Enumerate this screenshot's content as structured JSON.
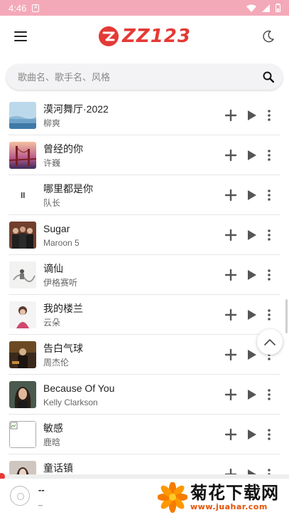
{
  "status_bar": {
    "time": "4:46",
    "notification_glyph": "A"
  },
  "header": {
    "logo_text": "ZZ123",
    "accent_color": "#e53935"
  },
  "search": {
    "placeholder": "歌曲名、歌手名、风格"
  },
  "songs": [
    {
      "title": "漠河舞厅·2022",
      "artist": "柳爽",
      "thumb": "sky-blue-cover"
    },
    {
      "title": "曾经的你",
      "artist": "许巍",
      "thumb": "bridge-sunset-cover"
    },
    {
      "title": "哪里都是你",
      "artist": "队长",
      "thumb": "minimal-white-cover"
    },
    {
      "title": "Sugar",
      "artist": "Maroon 5",
      "thumb": "band-photo-cover"
    },
    {
      "title": "谪仙",
      "artist": "伊格赛听",
      "thumb": "ink-painting-cover"
    },
    {
      "title": "我的楼兰",
      "artist": "云朵",
      "thumb": "singer-portrait-cover"
    },
    {
      "title": "告白气球",
      "artist": "周杰伦",
      "thumb": "jay-chou-cover"
    },
    {
      "title": "Because Of You",
      "artist": "Kelly Clarkson",
      "thumb": "kelly-clarkson-cover"
    },
    {
      "title": "敏感",
      "artist": "鹿晗",
      "thumb": "broken-image"
    },
    {
      "title": "童话镇",
      "artist": "",
      "thumb": "girl-portrait-cover"
    }
  ],
  "player": {
    "title": "--",
    "artist": "_",
    "progress": 0
  },
  "watermark": {
    "title": "菊花下载网",
    "url": "www.juahar.com"
  }
}
